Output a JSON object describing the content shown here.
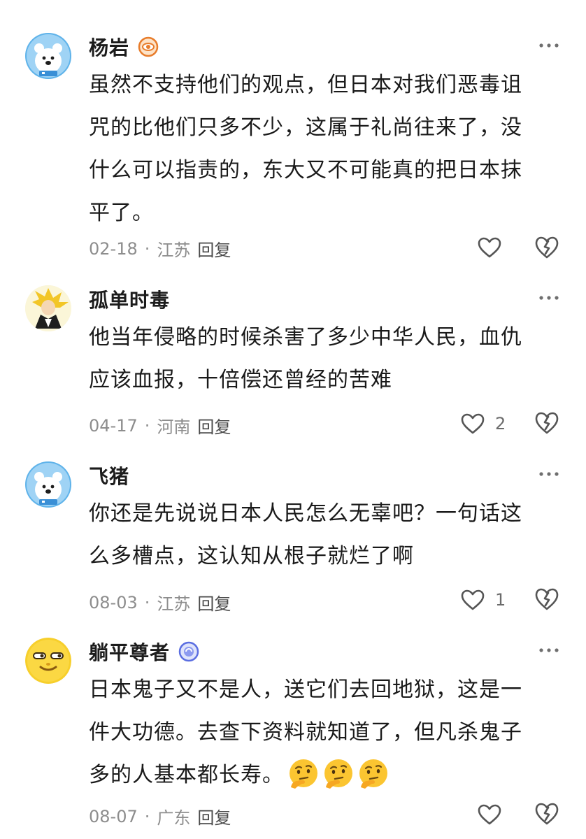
{
  "comments": [
    {
      "user": "杨岩",
      "avatar": "polar-bear-avatar",
      "badge": "eye-badge-icon",
      "lines": [
        "虽然不支持他们的观点，但日本对我们恶毒诅",
        "咒的比他们只多不少，这属于礼尚往来了，没",
        "什么可以指责的，东大又不可能真的把日本抹",
        "平了。"
      ],
      "date": "02-18",
      "location": "江苏",
      "reply": "回复",
      "likes": ""
    },
    {
      "user": "孤单时毒",
      "avatar": "anime-character-avatar",
      "lines": [
        "他当年侵略的时候杀害了多少中华人民，血仇",
        "应该血报，十倍偿还曾经的苦难"
      ],
      "date": "04-17",
      "location": "河南",
      "reply": "回复",
      "likes": "2"
    },
    {
      "user": "飞猪",
      "avatar": "polar-bear-avatar",
      "lines": [
        "你还是先说说日本人民怎么无辜吧？一句话这",
        "么多槽点，这认知从根子就烂了啊"
      ],
      "date": "08-03",
      "location": "江苏",
      "reply": "回复",
      "likes": "1"
    },
    {
      "user": "躺平尊者",
      "avatar": "smug-face-avatar",
      "badge": "blue-badge-icon",
      "lines": [
        "日本鬼子又不是人，送它们去回地狱，这是一",
        "件大功德。去查下资料就知道了，但凡杀鬼子",
        "多的人基本都长寿。"
      ],
      "emojis": [
        "thinking-face-emoji",
        "thinking-face-emoji",
        "thinking-face-emoji"
      ],
      "date": "08-07",
      "location": "广东",
      "reply": "回复",
      "likes": ""
    }
  ],
  "separator": "·",
  "colors": {
    "meta_text": "#8d8d8d",
    "badge_orange": "#e87d2c",
    "badge_blue": "#5b6ee1"
  }
}
